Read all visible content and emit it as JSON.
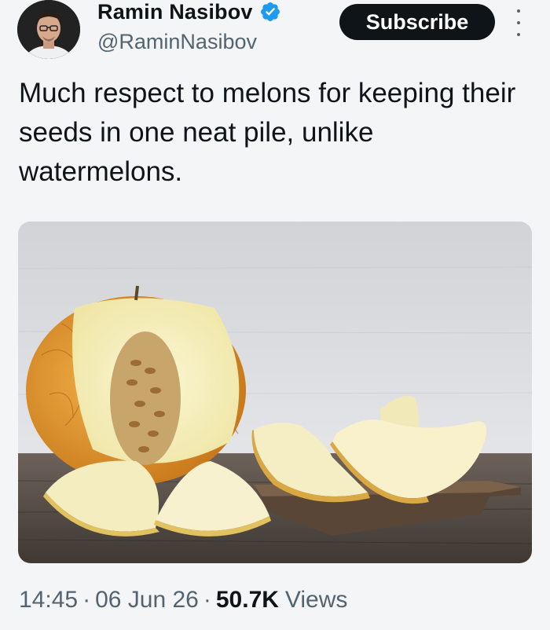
{
  "author": {
    "display_name": "Ramin Nasibov",
    "handle": "@RaminNasibov",
    "verified": true,
    "verified_color": "#1d9bf0"
  },
  "actions": {
    "subscribe_label": "Subscribe",
    "more_icon": "more-vertical-icon"
  },
  "tweet": {
    "text": "Much respect to melons for keeping their seeds in one neat pile, unlike watermelons.",
    "image_icon": "melon-photo"
  },
  "meta": {
    "time": "14:45",
    "separator": "·",
    "date": "06 Jun 26",
    "views_count": "50.7K",
    "views_label": "Views"
  },
  "colors": {
    "background": "#f4f5f7",
    "text_primary": "#0f1419",
    "text_secondary": "#536471",
    "button_bg": "#0f1419"
  }
}
